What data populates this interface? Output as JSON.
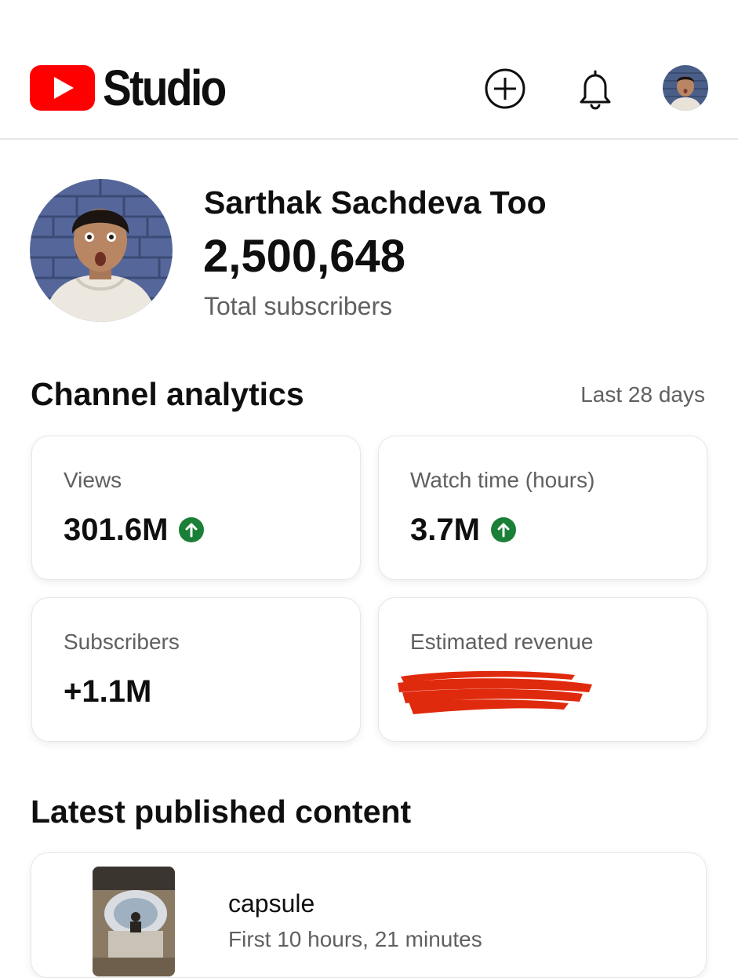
{
  "header": {
    "app_title": "Studio",
    "create_icon": "plus-circle-icon",
    "notifications_icon": "bell-icon",
    "account_icon": "avatar"
  },
  "channel": {
    "name": "Sarthak Sachdeva Too",
    "subscriber_count": "2,500,648",
    "subscriber_label": "Total subscribers"
  },
  "analytics": {
    "title": "Channel analytics",
    "period": "Last 28 days",
    "cards": [
      {
        "label": "Views",
        "value": "301.6M",
        "trend": "up"
      },
      {
        "label": "Watch time (hours)",
        "value": "3.7M",
        "trend": "up"
      },
      {
        "label": "Subscribers",
        "value": "+1.1M"
      },
      {
        "label": "Estimated revenue",
        "value_redacted": true
      }
    ]
  },
  "latest": {
    "title": "Latest published content",
    "video": {
      "title": "capsule",
      "meta": "First 10 hours, 21 minutes"
    }
  },
  "colors": {
    "brand_red": "#ff0000",
    "trend_green": "#1a7f37",
    "redaction": "#e02a0e",
    "secondary_text": "#606060"
  }
}
